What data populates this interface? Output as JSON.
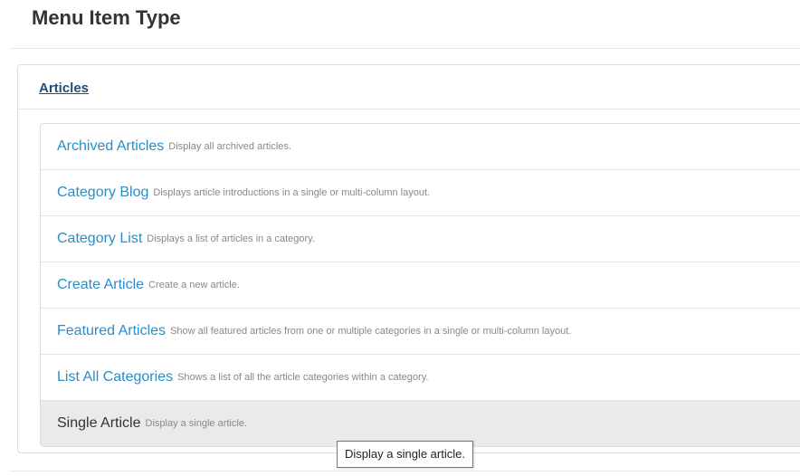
{
  "page": {
    "title": "Menu Item Type"
  },
  "accordion": {
    "heading": "Articles"
  },
  "items": [
    {
      "label": "Archived Articles",
      "description": "Display all archived articles."
    },
    {
      "label": "Category Blog",
      "description": "Displays article introductions in a single or multi-column layout."
    },
    {
      "label": "Category List",
      "description": "Displays a list of articles in a category."
    },
    {
      "label": "Create Article",
      "description": "Create a new article."
    },
    {
      "label": "Featured Articles",
      "description": "Show all featured articles from one or multiple categories in a single or multi-column layout."
    },
    {
      "label": "List All Categories",
      "description": "Shows a list of all the article categories within a category."
    },
    {
      "label": "Single Article",
      "description": "Display a single article."
    }
  ],
  "tooltip": {
    "text": "Display a single article."
  },
  "colors": {
    "link": "#2a8dc8",
    "heading_link": "#1f4e7a",
    "hover_row": "#eaeaea"
  }
}
